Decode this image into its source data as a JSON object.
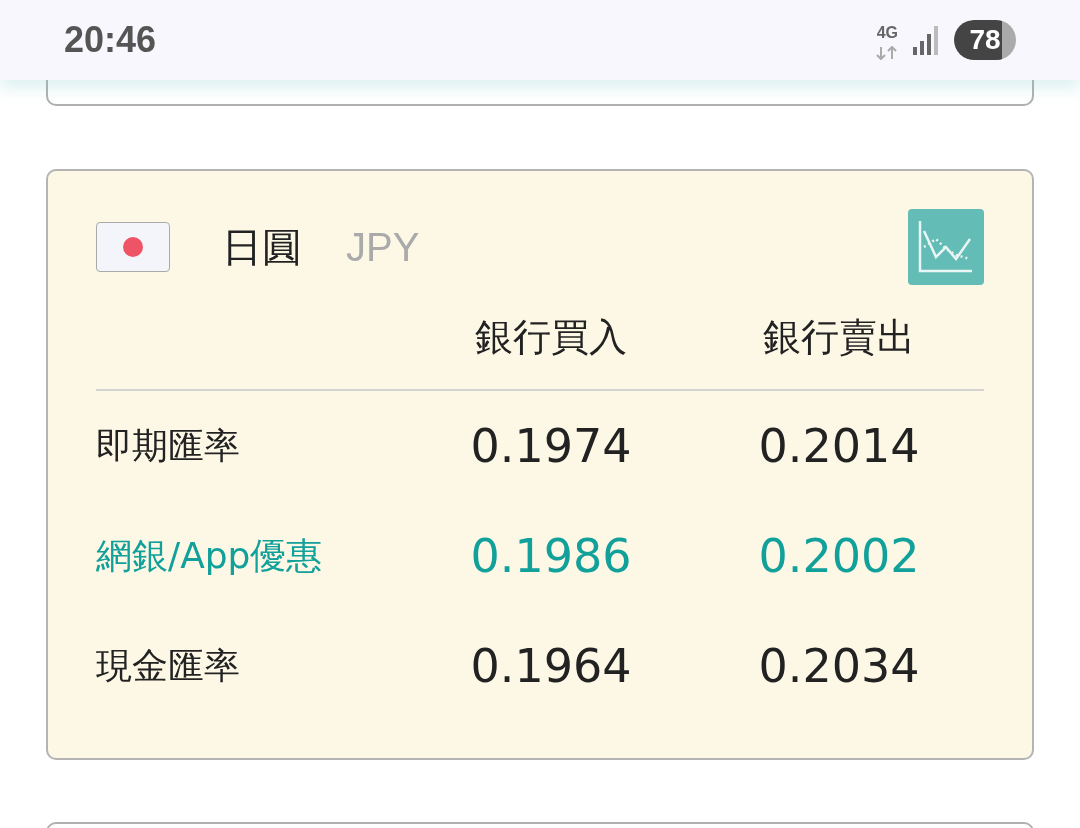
{
  "status_bar": {
    "time": "20:46",
    "network": "4G",
    "battery": "78"
  },
  "card": {
    "currency_name": "日圓",
    "currency_code": "JPY",
    "columns": [
      "銀行買入",
      "銀行賣出"
    ],
    "rows": [
      {
        "label": "即期匯率",
        "buy": "0.1974",
        "sell": "0.2014",
        "highlighted": false
      },
      {
        "label": "網銀/App優惠",
        "buy": "0.1986",
        "sell": "0.2002",
        "highlighted": true
      },
      {
        "label": "現金匯率",
        "buy": "0.1964",
        "sell": "0.2034",
        "highlighted": false
      }
    ]
  }
}
